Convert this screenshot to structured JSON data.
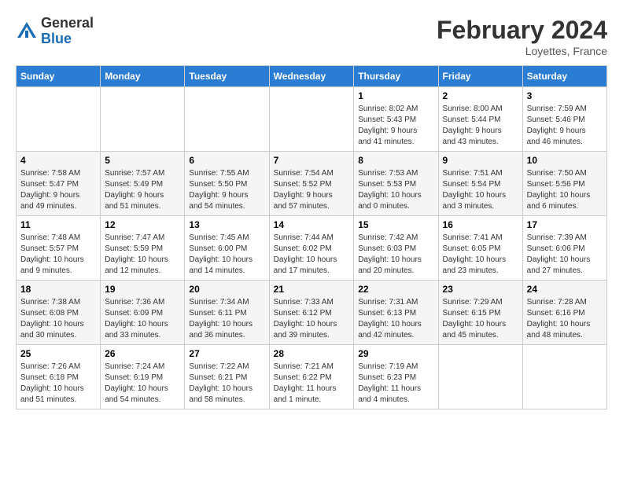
{
  "header": {
    "logo_general": "General",
    "logo_blue": "Blue",
    "month_year": "February 2024",
    "location": "Loyettes, France"
  },
  "days_of_week": [
    "Sunday",
    "Monday",
    "Tuesday",
    "Wednesday",
    "Thursday",
    "Friday",
    "Saturday"
  ],
  "weeks": [
    [
      {
        "num": "",
        "info": ""
      },
      {
        "num": "",
        "info": ""
      },
      {
        "num": "",
        "info": ""
      },
      {
        "num": "",
        "info": ""
      },
      {
        "num": "1",
        "info": "Sunrise: 8:02 AM\nSunset: 5:43 PM\nDaylight: 9 hours\nand 41 minutes."
      },
      {
        "num": "2",
        "info": "Sunrise: 8:00 AM\nSunset: 5:44 PM\nDaylight: 9 hours\nand 43 minutes."
      },
      {
        "num": "3",
        "info": "Sunrise: 7:59 AM\nSunset: 5:46 PM\nDaylight: 9 hours\nand 46 minutes."
      }
    ],
    [
      {
        "num": "4",
        "info": "Sunrise: 7:58 AM\nSunset: 5:47 PM\nDaylight: 9 hours\nand 49 minutes."
      },
      {
        "num": "5",
        "info": "Sunrise: 7:57 AM\nSunset: 5:49 PM\nDaylight: 9 hours\nand 51 minutes."
      },
      {
        "num": "6",
        "info": "Sunrise: 7:55 AM\nSunset: 5:50 PM\nDaylight: 9 hours\nand 54 minutes."
      },
      {
        "num": "7",
        "info": "Sunrise: 7:54 AM\nSunset: 5:52 PM\nDaylight: 9 hours\nand 57 minutes."
      },
      {
        "num": "8",
        "info": "Sunrise: 7:53 AM\nSunset: 5:53 PM\nDaylight: 10 hours\nand 0 minutes."
      },
      {
        "num": "9",
        "info": "Sunrise: 7:51 AM\nSunset: 5:54 PM\nDaylight: 10 hours\nand 3 minutes."
      },
      {
        "num": "10",
        "info": "Sunrise: 7:50 AM\nSunset: 5:56 PM\nDaylight: 10 hours\nand 6 minutes."
      }
    ],
    [
      {
        "num": "11",
        "info": "Sunrise: 7:48 AM\nSunset: 5:57 PM\nDaylight: 10 hours\nand 9 minutes."
      },
      {
        "num": "12",
        "info": "Sunrise: 7:47 AM\nSunset: 5:59 PM\nDaylight: 10 hours\nand 12 minutes."
      },
      {
        "num": "13",
        "info": "Sunrise: 7:45 AM\nSunset: 6:00 PM\nDaylight: 10 hours\nand 14 minutes."
      },
      {
        "num": "14",
        "info": "Sunrise: 7:44 AM\nSunset: 6:02 PM\nDaylight: 10 hours\nand 17 minutes."
      },
      {
        "num": "15",
        "info": "Sunrise: 7:42 AM\nSunset: 6:03 PM\nDaylight: 10 hours\nand 20 minutes."
      },
      {
        "num": "16",
        "info": "Sunrise: 7:41 AM\nSunset: 6:05 PM\nDaylight: 10 hours\nand 23 minutes."
      },
      {
        "num": "17",
        "info": "Sunrise: 7:39 AM\nSunset: 6:06 PM\nDaylight: 10 hours\nand 27 minutes."
      }
    ],
    [
      {
        "num": "18",
        "info": "Sunrise: 7:38 AM\nSunset: 6:08 PM\nDaylight: 10 hours\nand 30 minutes."
      },
      {
        "num": "19",
        "info": "Sunrise: 7:36 AM\nSunset: 6:09 PM\nDaylight: 10 hours\nand 33 minutes."
      },
      {
        "num": "20",
        "info": "Sunrise: 7:34 AM\nSunset: 6:11 PM\nDaylight: 10 hours\nand 36 minutes."
      },
      {
        "num": "21",
        "info": "Sunrise: 7:33 AM\nSunset: 6:12 PM\nDaylight: 10 hours\nand 39 minutes."
      },
      {
        "num": "22",
        "info": "Sunrise: 7:31 AM\nSunset: 6:13 PM\nDaylight: 10 hours\nand 42 minutes."
      },
      {
        "num": "23",
        "info": "Sunrise: 7:29 AM\nSunset: 6:15 PM\nDaylight: 10 hours\nand 45 minutes."
      },
      {
        "num": "24",
        "info": "Sunrise: 7:28 AM\nSunset: 6:16 PM\nDaylight: 10 hours\nand 48 minutes."
      }
    ],
    [
      {
        "num": "25",
        "info": "Sunrise: 7:26 AM\nSunset: 6:18 PM\nDaylight: 10 hours\nand 51 minutes."
      },
      {
        "num": "26",
        "info": "Sunrise: 7:24 AM\nSunset: 6:19 PM\nDaylight: 10 hours\nand 54 minutes."
      },
      {
        "num": "27",
        "info": "Sunrise: 7:22 AM\nSunset: 6:21 PM\nDaylight: 10 hours\nand 58 minutes."
      },
      {
        "num": "28",
        "info": "Sunrise: 7:21 AM\nSunset: 6:22 PM\nDaylight: 11 hours\nand 1 minute."
      },
      {
        "num": "29",
        "info": "Sunrise: 7:19 AM\nSunset: 6:23 PM\nDaylight: 11 hours\nand 4 minutes."
      },
      {
        "num": "",
        "info": ""
      },
      {
        "num": "",
        "info": ""
      }
    ]
  ]
}
